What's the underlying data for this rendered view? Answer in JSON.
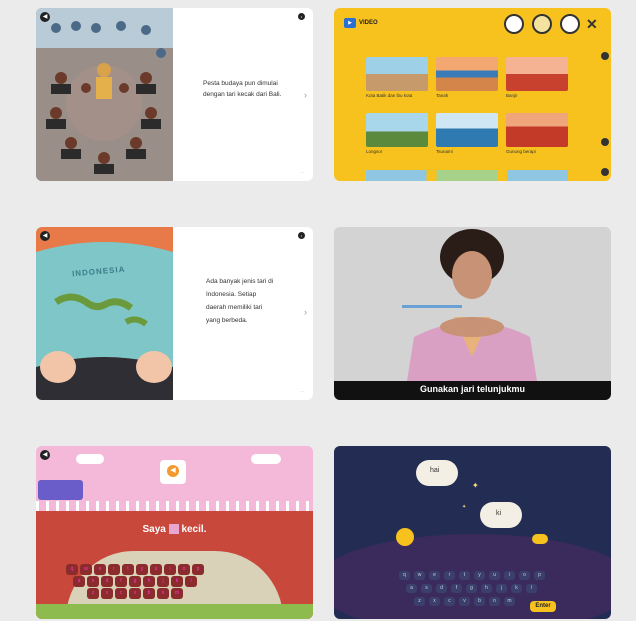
{
  "story1": {
    "text": "Pesta budaya pun dimulai dengan tari kecak dari Bali."
  },
  "video": {
    "header_label": "VIDEO",
    "items": [
      {
        "label": "Kota Batik dan ibu kota"
      },
      {
        "label": "Tanah"
      },
      {
        "label": "Banjir"
      },
      {
        "label": "Longsor"
      },
      {
        "label": "Tsunami"
      },
      {
        "label": "Gunung berapi"
      }
    ]
  },
  "story2": {
    "text": "Ada banyak jenis tari di Indonesia. Setiap daerah memiliki tari yang berbeda.",
    "map_title": "INDONESIA"
  },
  "lesson_video": {
    "subtitle": "Gunakan jari telunjukmu"
  },
  "typing_game": {
    "sentence_prefix": "Saya",
    "sentence_suffix": "kecil.",
    "keys_row1": [
      "q",
      "w",
      "e",
      "r",
      "t",
      "y",
      "u",
      "i",
      "o",
      "p"
    ],
    "keys_row2": [
      "a",
      "s",
      "d",
      "f",
      "g",
      "h",
      "j",
      "k",
      "l"
    ],
    "keys_row3": [
      "z",
      "x",
      "c",
      "v",
      "b",
      "n",
      "m"
    ]
  },
  "sheep_game": {
    "word1": "hai",
    "word2": "ki",
    "enter_label": "Enter",
    "keys_row1": [
      "q",
      "w",
      "e",
      "r",
      "t",
      "y",
      "u",
      "i",
      "o",
      "p"
    ],
    "keys_row2": [
      "a",
      "s",
      "d",
      "f",
      "g",
      "h",
      "j",
      "k",
      "l"
    ],
    "keys_row3": [
      "z",
      "x",
      "c",
      "v",
      "b",
      "n",
      "m"
    ]
  },
  "colors": {
    "video_bg": "#f7c21d",
    "night_bg": "#232c52",
    "pink_bg": "#f4b9d8",
    "brick": "#c9483c"
  }
}
